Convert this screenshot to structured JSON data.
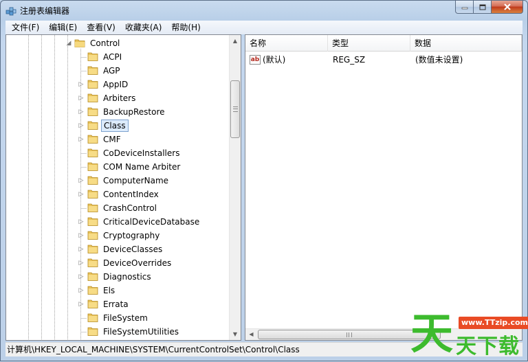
{
  "window": {
    "title": "注册表编辑器",
    "accent_color": "#3399ff"
  },
  "menu": {
    "items": [
      "文件(F)",
      "编辑(E)",
      "查看(V)",
      "收藏夹(A)",
      "帮助(H)"
    ]
  },
  "tree": {
    "parent": {
      "label": "Control",
      "expanded": true
    },
    "children": [
      {
        "label": "ACPI",
        "has_children": false
      },
      {
        "label": "AGP",
        "has_children": false
      },
      {
        "label": "AppID",
        "has_children": true
      },
      {
        "label": "Arbiters",
        "has_children": true
      },
      {
        "label": "BackupRestore",
        "has_children": true
      },
      {
        "label": "Class",
        "has_children": true,
        "selected": true
      },
      {
        "label": "CMF",
        "has_children": true
      },
      {
        "label": "CoDeviceInstallers",
        "has_children": false
      },
      {
        "label": "COM Name Arbiter",
        "has_children": false
      },
      {
        "label": "ComputerName",
        "has_children": true
      },
      {
        "label": "ContentIndex",
        "has_children": true
      },
      {
        "label": "CrashControl",
        "has_children": false
      },
      {
        "label": "CriticalDeviceDatabase",
        "has_children": true
      },
      {
        "label": "Cryptography",
        "has_children": true
      },
      {
        "label": "DeviceClasses",
        "has_children": true
      },
      {
        "label": "DeviceOverrides",
        "has_children": true
      },
      {
        "label": "Diagnostics",
        "has_children": true
      },
      {
        "label": "Els",
        "has_children": true
      },
      {
        "label": "Errata",
        "has_children": true
      },
      {
        "label": "FileSystem",
        "has_children": false
      },
      {
        "label": "FileSystemUtilities",
        "has_children": false
      }
    ]
  },
  "list": {
    "columns": [
      "名称",
      "类型",
      "数据"
    ],
    "rows": [
      {
        "icon": "string-value-icon",
        "icon_text": "ab",
        "name": "(默认)",
        "type": "REG_SZ",
        "data": "(数值未设置)"
      }
    ]
  },
  "status": {
    "path": "计算机\\HKEY_LOCAL_MACHINE\\SYSTEM\\CurrentControlSet\\Control\\Class"
  },
  "watermark": {
    "big": "天",
    "url": "www.TTzip.com",
    "small": "天下载"
  }
}
